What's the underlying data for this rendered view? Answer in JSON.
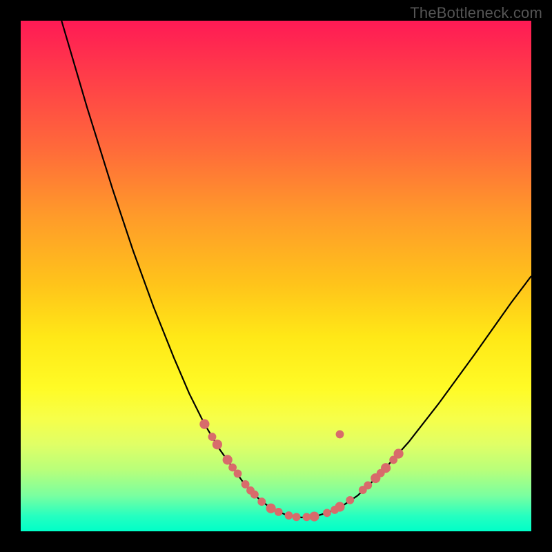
{
  "watermark": "TheBottleneck.com",
  "colors": {
    "frame": "#000000",
    "curve": "#000000",
    "marker": "#d86b6b",
    "gradient_top": "#ff1a55",
    "gradient_bottom": "#00ffc8"
  },
  "chart_data": {
    "type": "line",
    "title": "",
    "xlabel": "",
    "ylabel": "",
    "xlim": [
      0,
      100
    ],
    "ylim": [
      0,
      100
    ],
    "series": [
      {
        "name": "bottleneck-curve",
        "x": [
          8,
          13,
          18,
          22,
          26,
          30,
          33,
          36,
          39,
          41.5,
          44,
          46.5,
          49,
          52,
          55,
          58,
          62,
          66,
          70,
          76,
          82,
          89,
          96,
          100
        ],
        "values": [
          100,
          83,
          67,
          55,
          44,
          34,
          27,
          21,
          16,
          12.5,
          9,
          6.5,
          4.5,
          3.2,
          2.7,
          3.0,
          4.3,
          7.0,
          10.8,
          17.5,
          25.2,
          34.8,
          44.7,
          50.0
        ]
      }
    ],
    "markers": [
      {
        "x": 36.0,
        "y": 21.0,
        "r": 1.2
      },
      {
        "x": 37.5,
        "y": 18.5,
        "r": 1.0
      },
      {
        "x": 38.5,
        "y": 17.0,
        "r": 1.2
      },
      {
        "x": 40.5,
        "y": 14.0,
        "r": 1.2
      },
      {
        "x": 41.5,
        "y": 12.5,
        "r": 1.0
      },
      {
        "x": 42.5,
        "y": 11.3,
        "r": 1.0
      },
      {
        "x": 44.0,
        "y": 9.2,
        "r": 1.0
      },
      {
        "x": 45.0,
        "y": 8.0,
        "r": 1.0
      },
      {
        "x": 45.8,
        "y": 7.2,
        "r": 1.0
      },
      {
        "x": 47.2,
        "y": 5.8,
        "r": 1.0
      },
      {
        "x": 49.0,
        "y": 4.5,
        "r": 1.2
      },
      {
        "x": 50.5,
        "y": 3.8,
        "r": 1.0
      },
      {
        "x": 52.5,
        "y": 3.1,
        "r": 1.0
      },
      {
        "x": 54.0,
        "y": 2.8,
        "r": 1.0
      },
      {
        "x": 56.0,
        "y": 2.8,
        "r": 1.0
      },
      {
        "x": 57.5,
        "y": 2.9,
        "r": 1.2
      },
      {
        "x": 60.0,
        "y": 3.6,
        "r": 1.0
      },
      {
        "x": 61.5,
        "y": 4.2,
        "r": 1.0
      },
      {
        "x": 62.5,
        "y": 4.8,
        "r": 1.2
      },
      {
        "x": 64.5,
        "y": 6.1,
        "r": 1.0
      },
      {
        "x": 67.0,
        "y": 8.1,
        "r": 1.0
      },
      {
        "x": 68.0,
        "y": 9.0,
        "r": 1.0
      },
      {
        "x": 69.5,
        "y": 10.4,
        "r": 1.2
      },
      {
        "x": 70.5,
        "y": 11.4,
        "r": 1.0
      },
      {
        "x": 71.5,
        "y": 12.4,
        "r": 1.2
      },
      {
        "x": 73.0,
        "y": 14.0,
        "r": 1.0
      },
      {
        "x": 74.0,
        "y": 15.2,
        "r": 1.2
      },
      {
        "x": 62.5,
        "y": 19.0,
        "r": 1.0
      }
    ]
  }
}
